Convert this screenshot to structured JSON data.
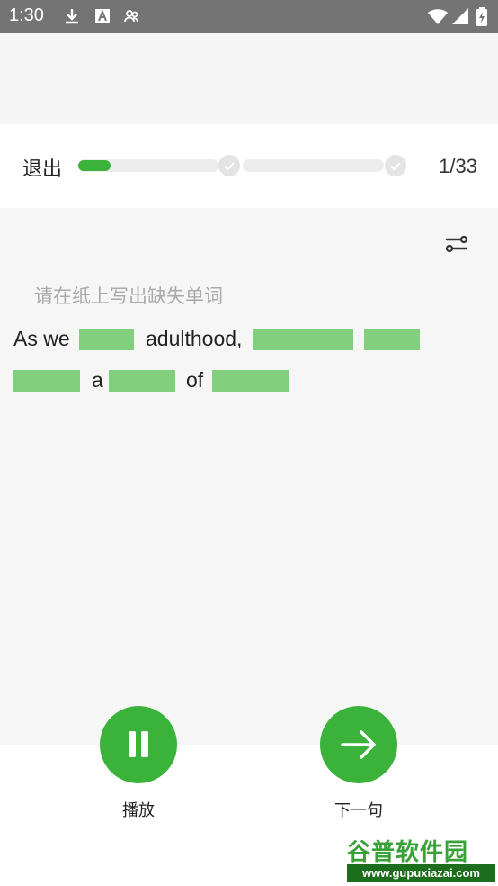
{
  "status_bar": {
    "time": "1:30",
    "left_icons": [
      "download-icon",
      "font-icon",
      "accounts-icon"
    ],
    "right_icons": [
      "wifi-icon",
      "signal-icon",
      "battery-icon"
    ]
  },
  "header": {
    "exit_label": "退出",
    "progress_text": "1/33",
    "progress_fraction": 0.03
  },
  "content": {
    "instruction": "请在纸上写出缺失单词",
    "line1_words": [
      "As we",
      "adulthood,"
    ],
    "line2_words": [
      "a",
      "of"
    ]
  },
  "controls": {
    "play_label": "播放",
    "next_label": "下一句"
  },
  "watermark": {
    "title": "谷普软件园",
    "url": "www.gupuxiazai.com"
  },
  "colors": {
    "accent": "#3bb33b",
    "blank": "#82cf7d",
    "status_bar": "#747474"
  }
}
